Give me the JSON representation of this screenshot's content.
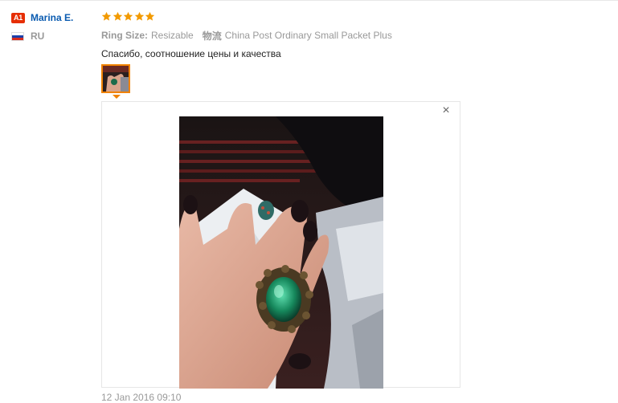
{
  "user": {
    "level_badge": "A1",
    "name": "Marina E.",
    "country": "RU"
  },
  "review": {
    "rating": 5,
    "star_color": "#f29a00",
    "attributes": [
      {
        "key": "Ring Size:",
        "value": "Resizable"
      },
      {
        "key": "物流",
        "value": "China Post Ordinary Small Packet Plus"
      }
    ],
    "text": "Спасибо, соотношение цены и качества",
    "date": "12 Jan 2016 09:10",
    "close_glyph": "×"
  },
  "colors": {
    "accent_orange": "#f08200",
    "name_blue": "#0a5bb0",
    "badge_red": "#e62e04"
  }
}
